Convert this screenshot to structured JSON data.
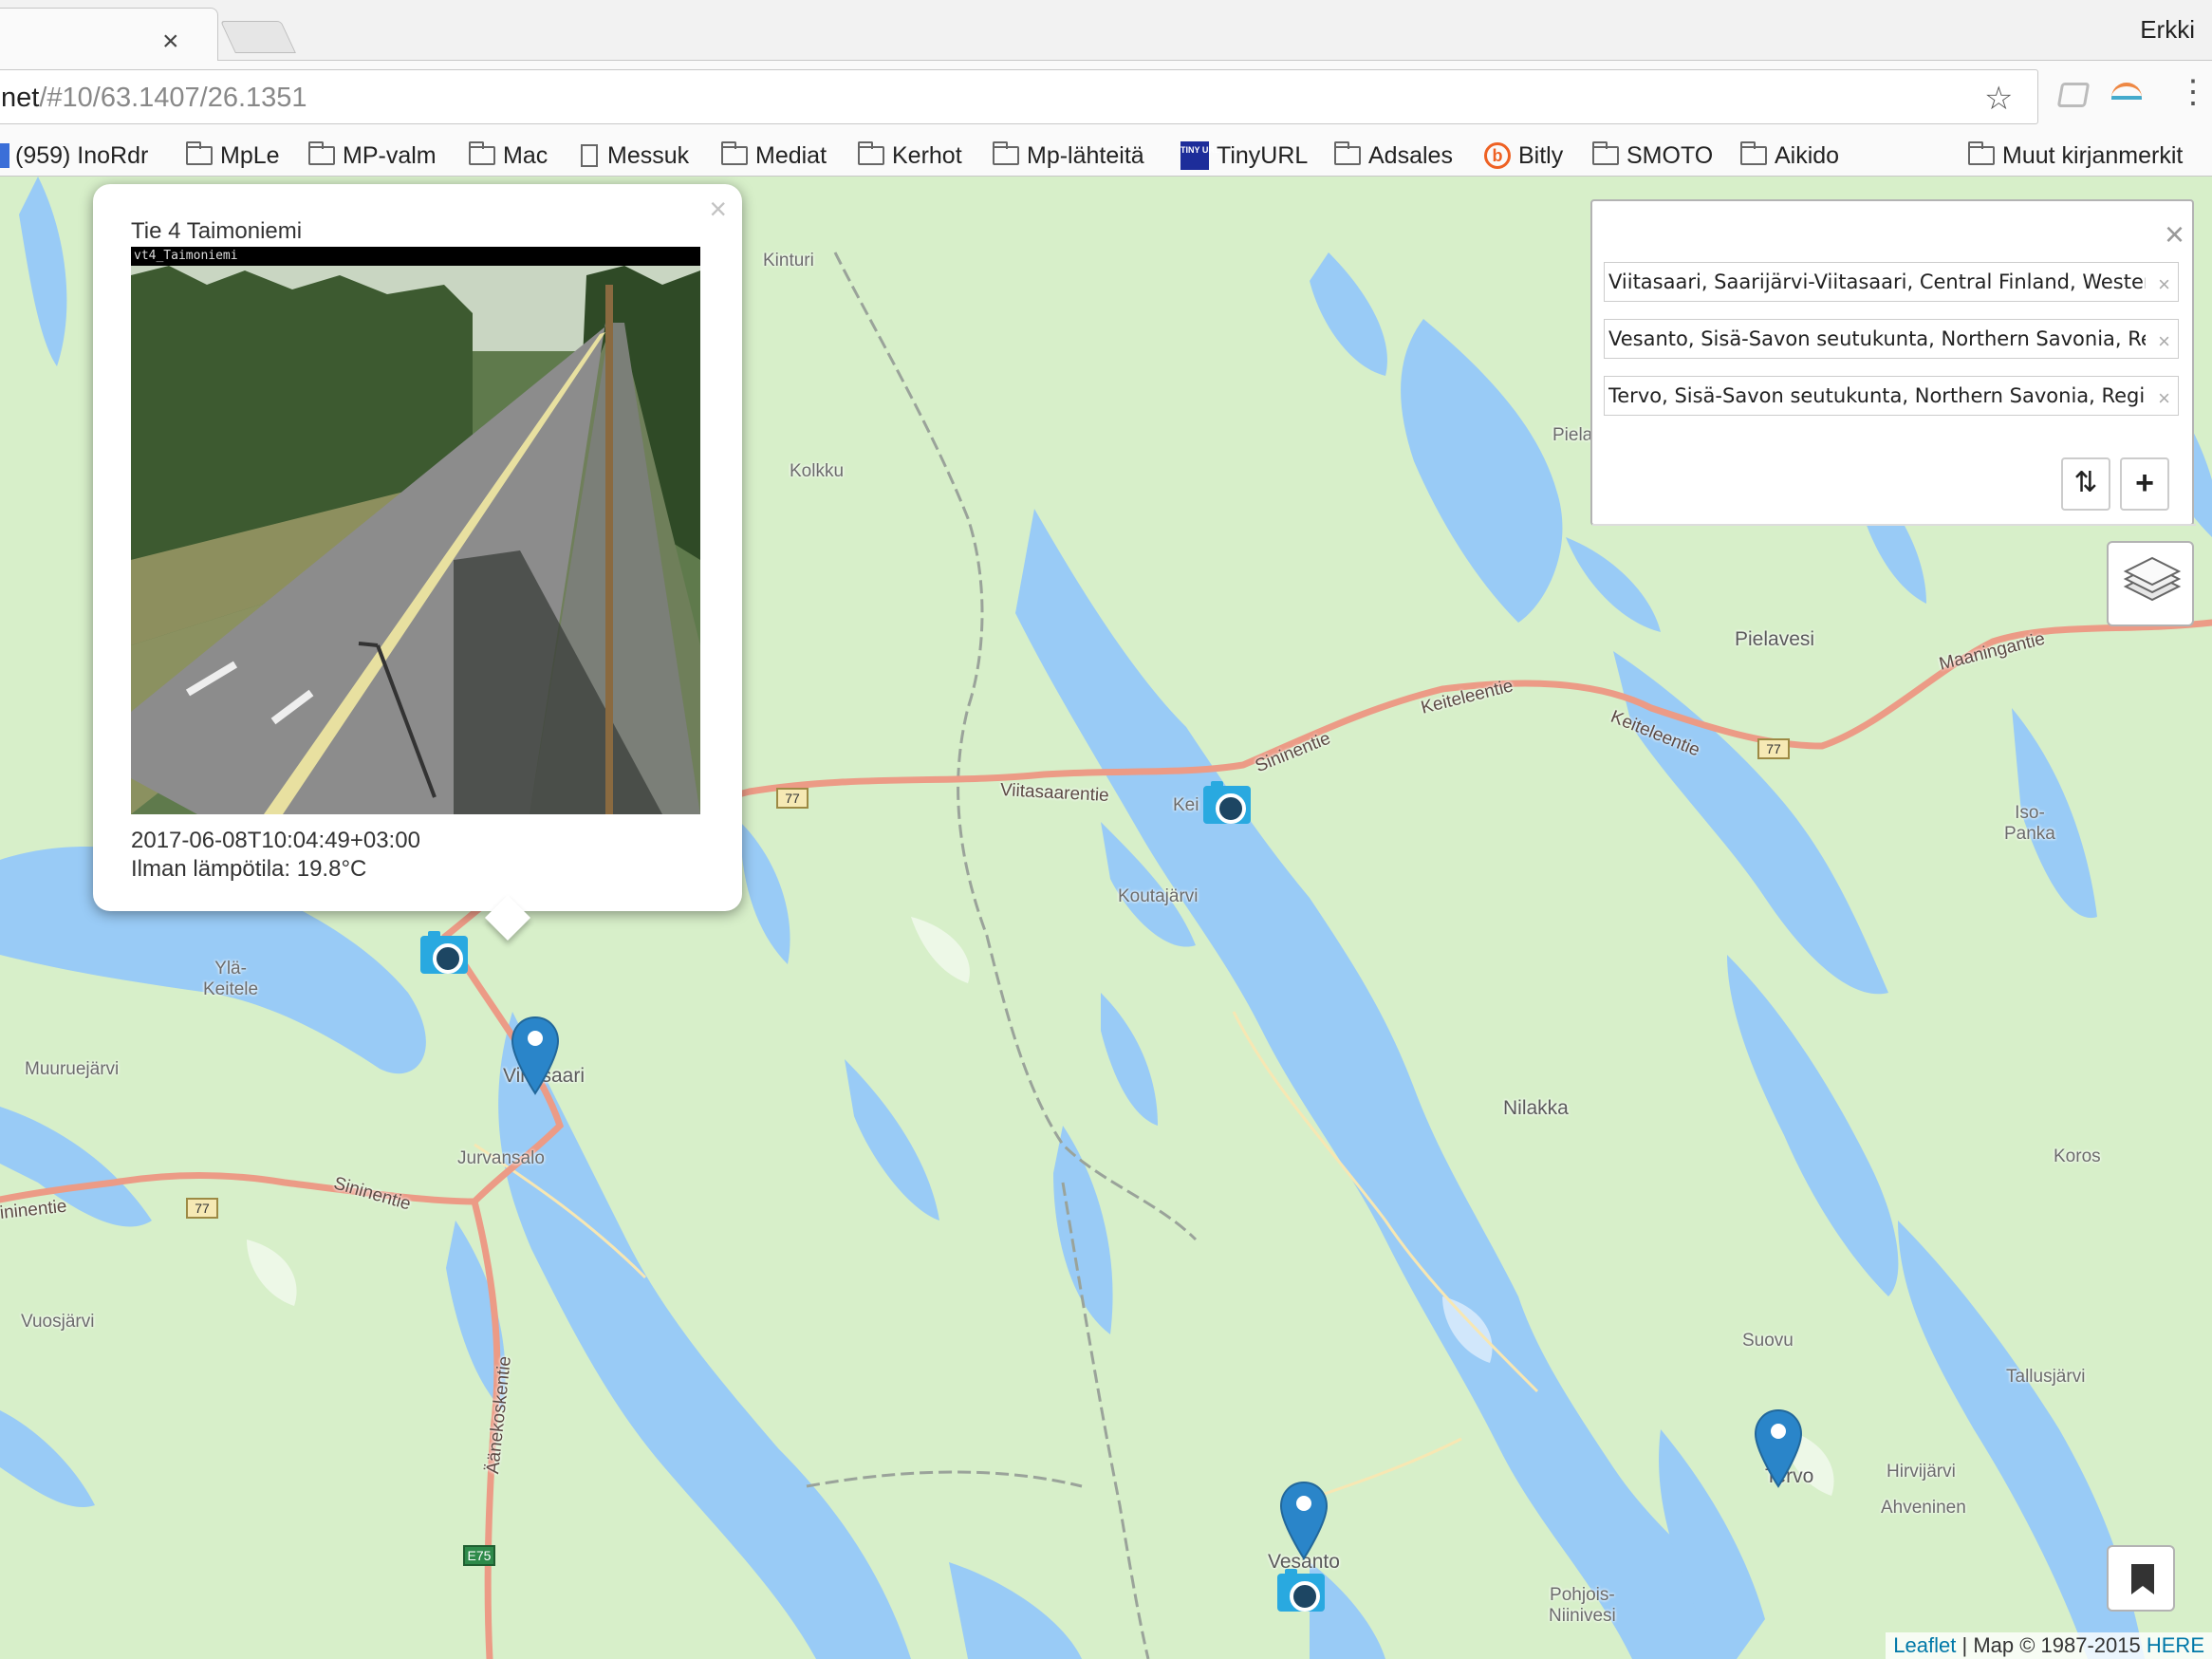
{
  "browser": {
    "tab_close": "×",
    "profile_name": "Erkki",
    "url_host": "net",
    "url_hash": "/#10/63.1407/26.1351",
    "menu_glyph": "⋮"
  },
  "bookmarks": [
    {
      "label": "(959) InoRdr",
      "icon": "rss-icon"
    },
    {
      "label": "MpLe",
      "icon": "folder-icon"
    },
    {
      "label": "MP-valm",
      "icon": "folder-icon"
    },
    {
      "label": "Mac",
      "icon": "folder-icon"
    },
    {
      "label": "Messuk",
      "icon": "page-icon"
    },
    {
      "label": "Mediat",
      "icon": "folder-icon"
    },
    {
      "label": "Kerhot",
      "icon": "folder-icon"
    },
    {
      "label": "Mp-lähteitä",
      "icon": "folder-icon"
    },
    {
      "label": "TinyURL",
      "icon": "tinyurl-icon"
    },
    {
      "label": "Adsales",
      "icon": "folder-icon"
    },
    {
      "label": "Bitly",
      "icon": "bitly-icon"
    },
    {
      "label": "SMOTO",
      "icon": "folder-icon"
    },
    {
      "label": "Aikido",
      "icon": "folder-icon"
    },
    {
      "label": "Muut kirjanmerkit",
      "icon": "folder-icon"
    }
  ],
  "tinyurl_glyph": "TINY URL",
  "bitly_glyph": "b",
  "popup": {
    "close": "×",
    "title": "Tie 4 Taimoniemi",
    "image_caption": "vt4_Taimoniemi",
    "timestamp": "2017-06-08T10:04:49+03:00",
    "temperature": "Ilman lämpötila: 19.8°C"
  },
  "routing": {
    "close": "×",
    "waypoints": [
      "Viitasaari, Saarijärvi-Viitasaari, Central Finland, Western",
      "Vesanto, Sisä-Savon seutukunta, Northern Savonia, Re",
      "Tervo, Sisä-Savon seutukunta, Northern Savonia, Regi"
    ],
    "remove": "×",
    "reverse_glyph": "⇅",
    "add_glyph": "+"
  },
  "places": {
    "kinturi": "Kinturi",
    "kolkku": "Kolkku",
    "pielaves_top": "Pielaves",
    "pielavesi": "Pielavesi",
    "kei": "Kei",
    "iso_panka": "Iso-\nPanka",
    "koutajarvi": "Koutajärvi",
    "yla_keitele": "Ylä-\nKeitele",
    "muuruejarvi": "Muuruejärvi",
    "viitasaari": "Viitasaari",
    "jurvansalo": "Jurvansalo",
    "nilakka": "Nilakka",
    "koros": "Koros",
    "vuosjarvi": "Vuosjärvi",
    "suovu": "Suovu",
    "tallusjarvi": "Tallusjärvi",
    "tervo": "Tervo",
    "hirvijarvi": "Hirvijärvi",
    "ahveninen": "Ahveninen",
    "vesanto": "Vesanto",
    "pohjois_niinivesi": "Pohjois-\nNiinivesi"
  },
  "roads": {
    "viitasaarentie": "Viitasaarentie",
    "sininentie_east": "Sininentie",
    "keiteleentie_1": "Keiteleentie",
    "keiteleentie_2": "Keiteleentie",
    "maaningantie": "Maaningantie",
    "sininentie_west": "Sininentie",
    "ininentie": "ininentie",
    "aanekoskentie": "Äänekoskentie",
    "shield_77": "77",
    "shield_e75": "E75"
  },
  "attribution": {
    "leaflet": "Leaflet",
    "separator": " | ",
    "map_credit": "Map © 1987-2015 ",
    "here": "HERE"
  },
  "colors": {
    "land": "#d7efc9",
    "water": "#99cbf6",
    "road": "#ec9b86",
    "marker_blue": "#2a85c9",
    "camera_blue": "#29a9e0"
  }
}
